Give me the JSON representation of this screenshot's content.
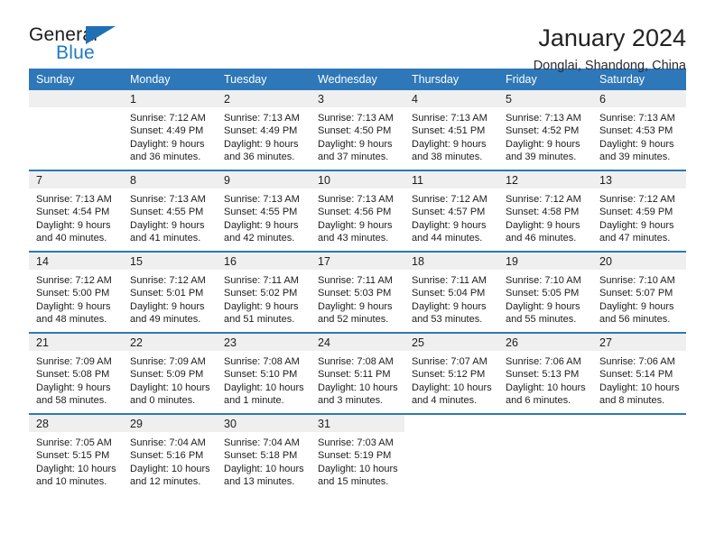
{
  "brand": {
    "name_top": "General",
    "name_bottom": "Blue",
    "accent_color": "#2079c3"
  },
  "header": {
    "title": "January 2024",
    "subtitle": "Donglai, Shandong, China"
  },
  "calendar": {
    "header_bg": "#2e77b8",
    "daynum_bg": "#efefef",
    "weekday_names": [
      "Sunday",
      "Monday",
      "Tuesday",
      "Wednesday",
      "Thursday",
      "Friday",
      "Saturday"
    ],
    "weeks": [
      [
        {
          "day": "",
          "lines": []
        },
        {
          "day": "1",
          "lines": [
            "Sunrise: 7:12 AM",
            "Sunset: 4:49 PM",
            "Daylight: 9 hours",
            "and 36 minutes."
          ]
        },
        {
          "day": "2",
          "lines": [
            "Sunrise: 7:13 AM",
            "Sunset: 4:49 PM",
            "Daylight: 9 hours",
            "and 36 minutes."
          ]
        },
        {
          "day": "3",
          "lines": [
            "Sunrise: 7:13 AM",
            "Sunset: 4:50 PM",
            "Daylight: 9 hours",
            "and 37 minutes."
          ]
        },
        {
          "day": "4",
          "lines": [
            "Sunrise: 7:13 AM",
            "Sunset: 4:51 PM",
            "Daylight: 9 hours",
            "and 38 minutes."
          ]
        },
        {
          "day": "5",
          "lines": [
            "Sunrise: 7:13 AM",
            "Sunset: 4:52 PM",
            "Daylight: 9 hours",
            "and 39 minutes."
          ]
        },
        {
          "day": "6",
          "lines": [
            "Sunrise: 7:13 AM",
            "Sunset: 4:53 PM",
            "Daylight: 9 hours",
            "and 39 minutes."
          ]
        }
      ],
      [
        {
          "day": "7",
          "lines": [
            "Sunrise: 7:13 AM",
            "Sunset: 4:54 PM",
            "Daylight: 9 hours",
            "and 40 minutes."
          ]
        },
        {
          "day": "8",
          "lines": [
            "Sunrise: 7:13 AM",
            "Sunset: 4:55 PM",
            "Daylight: 9 hours",
            "and 41 minutes."
          ]
        },
        {
          "day": "9",
          "lines": [
            "Sunrise: 7:13 AM",
            "Sunset: 4:55 PM",
            "Daylight: 9 hours",
            "and 42 minutes."
          ]
        },
        {
          "day": "10",
          "lines": [
            "Sunrise: 7:13 AM",
            "Sunset: 4:56 PM",
            "Daylight: 9 hours",
            "and 43 minutes."
          ]
        },
        {
          "day": "11",
          "lines": [
            "Sunrise: 7:12 AM",
            "Sunset: 4:57 PM",
            "Daylight: 9 hours",
            "and 44 minutes."
          ]
        },
        {
          "day": "12",
          "lines": [
            "Sunrise: 7:12 AM",
            "Sunset: 4:58 PM",
            "Daylight: 9 hours",
            "and 46 minutes."
          ]
        },
        {
          "day": "13",
          "lines": [
            "Sunrise: 7:12 AM",
            "Sunset: 4:59 PM",
            "Daylight: 9 hours",
            "and 47 minutes."
          ]
        }
      ],
      [
        {
          "day": "14",
          "lines": [
            "Sunrise: 7:12 AM",
            "Sunset: 5:00 PM",
            "Daylight: 9 hours",
            "and 48 minutes."
          ]
        },
        {
          "day": "15",
          "lines": [
            "Sunrise: 7:12 AM",
            "Sunset: 5:01 PM",
            "Daylight: 9 hours",
            "and 49 minutes."
          ]
        },
        {
          "day": "16",
          "lines": [
            "Sunrise: 7:11 AM",
            "Sunset: 5:02 PM",
            "Daylight: 9 hours",
            "and 51 minutes."
          ]
        },
        {
          "day": "17",
          "lines": [
            "Sunrise: 7:11 AM",
            "Sunset: 5:03 PM",
            "Daylight: 9 hours",
            "and 52 minutes."
          ]
        },
        {
          "day": "18",
          "lines": [
            "Sunrise: 7:11 AM",
            "Sunset: 5:04 PM",
            "Daylight: 9 hours",
            "and 53 minutes."
          ]
        },
        {
          "day": "19",
          "lines": [
            "Sunrise: 7:10 AM",
            "Sunset: 5:05 PM",
            "Daylight: 9 hours",
            "and 55 minutes."
          ]
        },
        {
          "day": "20",
          "lines": [
            "Sunrise: 7:10 AM",
            "Sunset: 5:07 PM",
            "Daylight: 9 hours",
            "and 56 minutes."
          ]
        }
      ],
      [
        {
          "day": "21",
          "lines": [
            "Sunrise: 7:09 AM",
            "Sunset: 5:08 PM",
            "Daylight: 9 hours",
            "and 58 minutes."
          ]
        },
        {
          "day": "22",
          "lines": [
            "Sunrise: 7:09 AM",
            "Sunset: 5:09 PM",
            "Daylight: 10 hours",
            "and 0 minutes."
          ]
        },
        {
          "day": "23",
          "lines": [
            "Sunrise: 7:08 AM",
            "Sunset: 5:10 PM",
            "Daylight: 10 hours",
            "and 1 minute."
          ]
        },
        {
          "day": "24",
          "lines": [
            "Sunrise: 7:08 AM",
            "Sunset: 5:11 PM",
            "Daylight: 10 hours",
            "and 3 minutes."
          ]
        },
        {
          "day": "25",
          "lines": [
            "Sunrise: 7:07 AM",
            "Sunset: 5:12 PM",
            "Daylight: 10 hours",
            "and 4 minutes."
          ]
        },
        {
          "day": "26",
          "lines": [
            "Sunrise: 7:06 AM",
            "Sunset: 5:13 PM",
            "Daylight: 10 hours",
            "and 6 minutes."
          ]
        },
        {
          "day": "27",
          "lines": [
            "Sunrise: 7:06 AM",
            "Sunset: 5:14 PM",
            "Daylight: 10 hours",
            "and 8 minutes."
          ]
        }
      ],
      [
        {
          "day": "28",
          "lines": [
            "Sunrise: 7:05 AM",
            "Sunset: 5:15 PM",
            "Daylight: 10 hours",
            "and 10 minutes."
          ]
        },
        {
          "day": "29",
          "lines": [
            "Sunrise: 7:04 AM",
            "Sunset: 5:16 PM",
            "Daylight: 10 hours",
            "and 12 minutes."
          ]
        },
        {
          "day": "30",
          "lines": [
            "Sunrise: 7:04 AM",
            "Sunset: 5:18 PM",
            "Daylight: 10 hours",
            "and 13 minutes."
          ]
        },
        {
          "day": "31",
          "lines": [
            "Sunrise: 7:03 AM",
            "Sunset: 5:19 PM",
            "Daylight: 10 hours",
            "and 15 minutes."
          ]
        },
        {
          "day": "",
          "lines": []
        },
        {
          "day": "",
          "lines": []
        },
        {
          "day": "",
          "lines": []
        }
      ]
    ]
  }
}
